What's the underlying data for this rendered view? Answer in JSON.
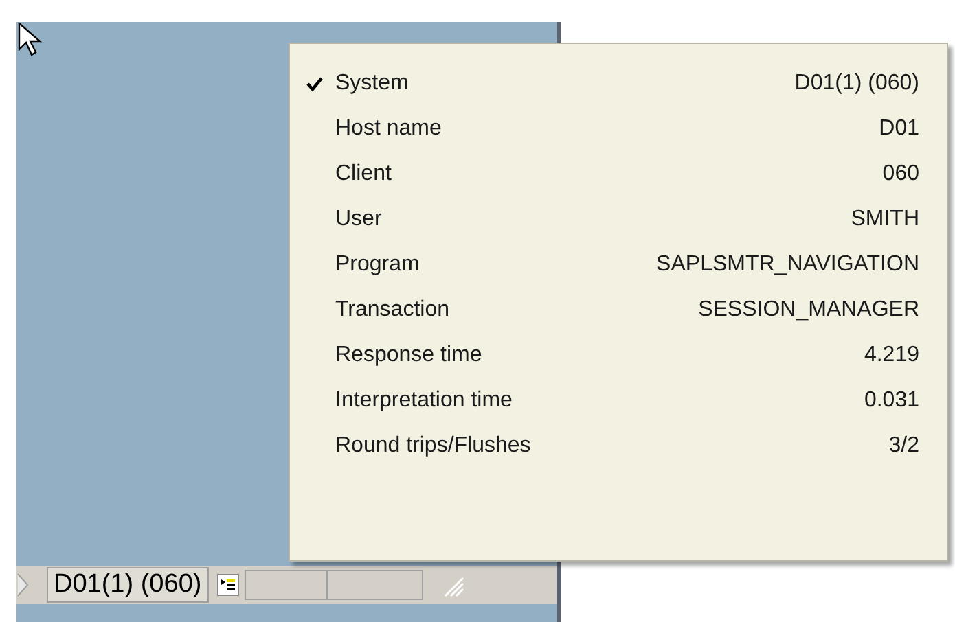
{
  "status_bar": {
    "system": "D01(1) (060)"
  },
  "menu": {
    "items": [
      {
        "label": "System",
        "value": "D01(1) (060)",
        "checked": true
      },
      {
        "label": "Host name",
        "value": "D01",
        "checked": false
      },
      {
        "label": "Client",
        "value": "060",
        "checked": false
      },
      {
        "label": "User",
        "value": "SMITH",
        "checked": false
      },
      {
        "label": "Program",
        "value": "SAPLSMTR_NAVIGATION",
        "checked": false
      },
      {
        "label": "Transaction",
        "value": "SESSION_MANAGER",
        "checked": false
      },
      {
        "label": "Response time",
        "value": "4.219",
        "checked": false
      },
      {
        "label": "Interpretation time",
        "value": "0.031",
        "checked": false
      },
      {
        "label": "Round trips/Flushes",
        "value": "3/2",
        "checked": false
      }
    ]
  }
}
